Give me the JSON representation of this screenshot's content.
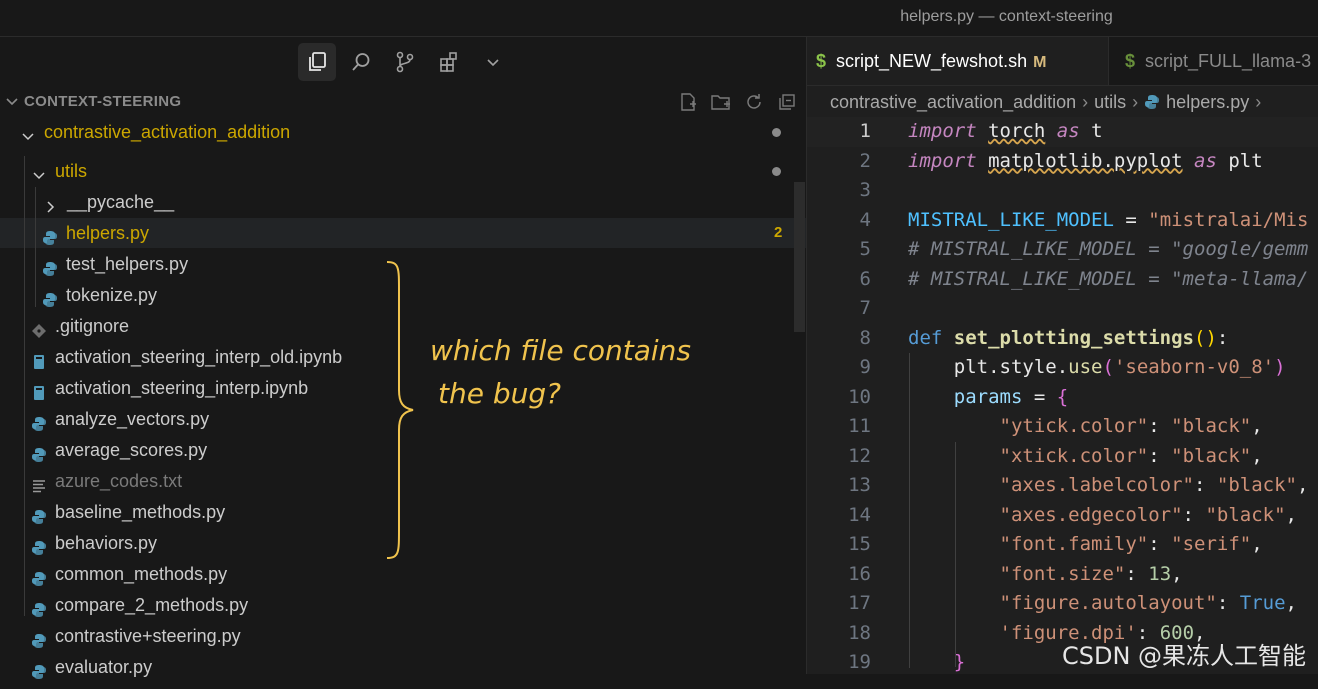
{
  "window": {
    "title": "helpers.py — context-steering"
  },
  "sidebar": {
    "activity_icons": [
      "files-icon",
      "search-icon",
      "source-control-icon",
      "extensions-icon",
      "chevron-down-icon"
    ],
    "explorer_title": "CONTEXT-STEERING",
    "explorer_actions": [
      "new-file-icon",
      "new-folder-icon",
      "refresh-icon",
      "collapse-all-icon"
    ],
    "tree": [
      {
        "label": "contrastive_activation_addition",
        "kind": "folder-open",
        "indent": 1,
        "color": "#cca700",
        "dot": true
      },
      {
        "label": "utils",
        "kind": "folder-open",
        "indent": 2,
        "color": "#cca700",
        "dot": true
      },
      {
        "label": "__pycache__",
        "kind": "folder-closed",
        "indent": 3
      },
      {
        "label": "helpers.py",
        "kind": "python",
        "indent": 3,
        "selected": true,
        "badge": "2",
        "color": "#cca700"
      },
      {
        "label": "test_helpers.py",
        "kind": "python",
        "indent": 3
      },
      {
        "label": "tokenize.py",
        "kind": "python",
        "indent": 3
      },
      {
        "label": ".gitignore",
        "kind": "git",
        "indent": 2
      },
      {
        "label": "activation_steering_interp_old.ipynb",
        "kind": "notebook",
        "indent": 2
      },
      {
        "label": "activation_steering_interp.ipynb",
        "kind": "notebook",
        "indent": 2
      },
      {
        "label": "analyze_vectors.py",
        "kind": "python",
        "indent": 2
      },
      {
        "label": "average_scores.py",
        "kind": "python",
        "indent": 2
      },
      {
        "label": "azure_codes.txt",
        "kind": "text",
        "indent": 2,
        "muted": true
      },
      {
        "label": "baseline_methods.py",
        "kind": "python",
        "indent": 2
      },
      {
        "label": "behaviors.py",
        "kind": "python",
        "indent": 2
      },
      {
        "label": "common_methods.py",
        "kind": "python",
        "indent": 2
      },
      {
        "label": "compare_2_methods.py",
        "kind": "python",
        "indent": 2
      },
      {
        "label": "contrastive+steering.py",
        "kind": "python",
        "indent": 2
      },
      {
        "label": "evaluator.py",
        "kind": "python",
        "indent": 2
      }
    ]
  },
  "annotation": {
    "line1": "which file contains",
    "line2": "the bug?"
  },
  "editor": {
    "tabs": [
      {
        "label": "script_NEW_fewshot.sh",
        "modified": "M",
        "active": true
      },
      {
        "label": "script_FULL_llama-3",
        "active": false
      }
    ],
    "breadcrumb": [
      "contrastive_activation_addition",
      "utils",
      "helpers.py"
    ],
    "lines": [
      {
        "n": "1",
        "html": "<span class='kw'>import</span> <span class='id wavy'>torch</span> <span class='kw'>as</span> <span class='id'>t</span>",
        "cur": true
      },
      {
        "n": "2",
        "html": "<span class='kw'>import</span> <span class='id wavy'>matplotlib.pyplot</span> <span class='kw'>as</span> <span class='id'>plt</span>"
      },
      {
        "n": "3",
        "html": ""
      },
      {
        "n": "4",
        "html": "<span class='var' style='color:#4fc1ff'>MISTRAL_LIKE_MODEL</span> <span class='id'>=</span> <span class='str'>\"mistralai/Mis</span>"
      },
      {
        "n": "5",
        "html": "<span class='cm'># MISTRAL_LIKE_MODEL = \"google/gemm</span>"
      },
      {
        "n": "6",
        "html": "<span class='cm'># MISTRAL_LIKE_MODEL = \"meta-llama/</span>"
      },
      {
        "n": "7",
        "html": ""
      },
      {
        "n": "8",
        "html": "<span class='def'>def</span> <span class='fn'>set_plotting_settings</span><span class='br'>()</span><span class='id'>:</span>"
      },
      {
        "n": "9",
        "html": "    <span class='id'>plt.style.</span><span class='fn' style='font-weight:normal'>use</span><span class='br' style='color:#da70d6'>(</span><span class='str'>'seaborn-v0_8'</span><span class='br' style='color:#da70d6'>)</span>"
      },
      {
        "n": "10",
        "html": "    <span class='var'>params</span> <span class='id'>=</span> <span class='br' style='color:#da70d6'>{</span>"
      },
      {
        "n": "11",
        "html": "        <span class='str'>\"ytick.color\"</span><span class='id'>:</span> <span class='str'>\"black\"</span><span class='id'>,</span>"
      },
      {
        "n": "12",
        "html": "        <span class='str'>\"xtick.color\"</span><span class='id'>:</span> <span class='str'>\"black\"</span><span class='id'>,</span>"
      },
      {
        "n": "13",
        "html": "        <span class='str'>\"axes.labelcolor\"</span><span class='id'>:</span> <span class='str'>\"black\"</span><span class='id'>,</span>"
      },
      {
        "n": "14",
        "html": "        <span class='str'>\"axes.edgecolor\"</span><span class='id'>:</span> <span class='str'>\"black\"</span><span class='id'>,</span>"
      },
      {
        "n": "15",
        "html": "        <span class='str'>\"font.family\"</span><span class='id'>:</span> <span class='str'>\"serif\"</span><span class='id'>,</span>"
      },
      {
        "n": "16",
        "html": "        <span class='str'>\"font.size\"</span><span class='id'>:</span> <span class='num'>13</span><span class='id'>,</span>"
      },
      {
        "n": "17",
        "html": "        <span class='str'>\"figure.autolayout\"</span><span class='id'>:</span> <span class='def'>True</span><span class='id'>,</span>"
      },
      {
        "n": "18",
        "html": "        <span class='str'>'figure.dpi'</span><span class='id'>:</span> <span class='num'>600</span><span class='id'>,</span>"
      },
      {
        "n": "19",
        "html": "    <span class='br' style='color:#da70d6'>}</span>"
      }
    ]
  },
  "watermark": "CSDN @果冻人工智能"
}
